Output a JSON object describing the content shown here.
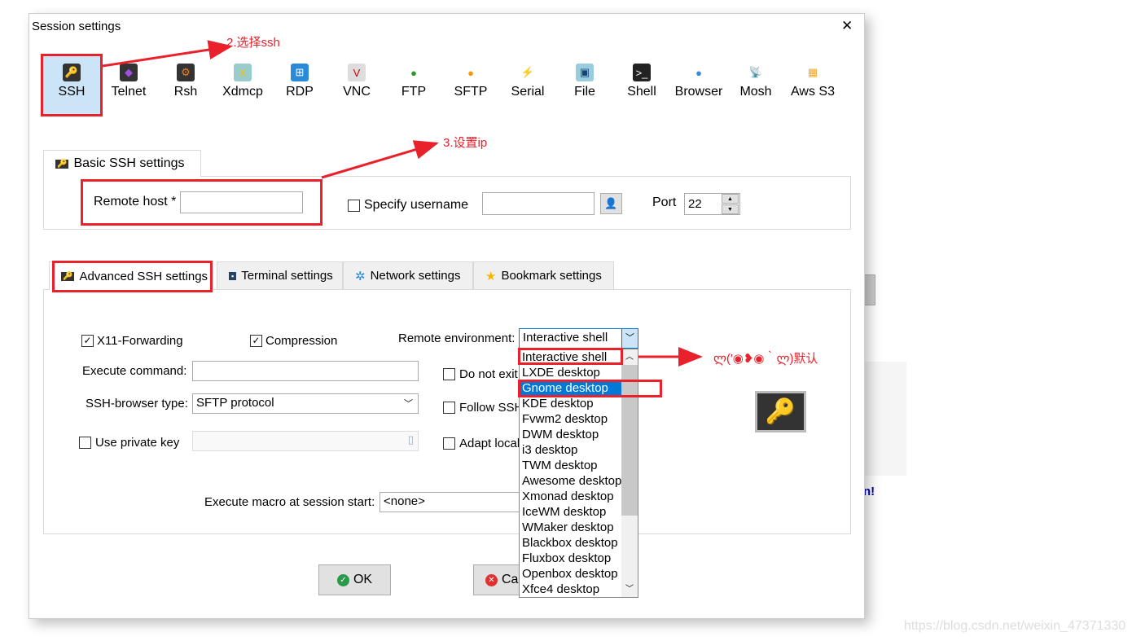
{
  "window": {
    "title": "Session settings",
    "close": "✕"
  },
  "protocols": [
    {
      "label": "SSH",
      "icon": "key-icon",
      "glyph": "🔑",
      "bg": "#333",
      "selected": true
    },
    {
      "label": "Telnet",
      "icon": "crystal-icon",
      "glyph": "◆",
      "bg": "#333",
      "color": "#a050e0"
    },
    {
      "label": "Rsh",
      "icon": "gears-icon",
      "glyph": "⚙",
      "bg": "#333",
      "color": "#f08020"
    },
    {
      "label": "Xdmcp",
      "icon": "x-monitor-icon",
      "glyph": "X",
      "bg": "#9cc"
    },
    {
      "label": "RDP",
      "icon": "windows-monitor-icon",
      "glyph": "⊞",
      "bg": "#2a8ad8",
      "color": "#fff"
    },
    {
      "label": "VNC",
      "icon": "vnc-monitor-icon",
      "glyph": "V",
      "bg": "#ddd",
      "color": "#c00"
    },
    {
      "label": "FTP",
      "icon": "green-globe-icon",
      "glyph": "●",
      "bg": "transparent",
      "color": "#2a9a2a"
    },
    {
      "label": "SFTP",
      "icon": "orange-globe-icon",
      "glyph": "●",
      "bg": "transparent",
      "color": "#f59a10"
    },
    {
      "label": "Serial",
      "icon": "plug-icon",
      "glyph": "⚡",
      "bg": "transparent",
      "color": "#777"
    },
    {
      "label": "File",
      "icon": "file-monitor-icon",
      "glyph": "▣",
      "bg": "#9cd",
      "color": "#147"
    },
    {
      "label": "Shell",
      "icon": "terminal-icon",
      "glyph": ">_",
      "bg": "#222",
      "color": "#fff"
    },
    {
      "label": "Browser",
      "icon": "globe-icon",
      "glyph": "●",
      "bg": "transparent",
      "color": "#3a8ad8"
    },
    {
      "label": "Mosh",
      "icon": "satellite-icon",
      "glyph": "📡",
      "bg": "transparent",
      "color": "#357"
    },
    {
      "label": "Aws S3",
      "icon": "cubes-icon",
      "glyph": "▦",
      "bg": "transparent",
      "color": "#f5a623"
    }
  ],
  "annotations": {
    "step2": "2.选择ssh",
    "step3": "3.设置ip",
    "default_note": "ლ(′◉❥◉｀ლ)默认"
  },
  "basic": {
    "tab": "Basic SSH settings",
    "remote_host_label": "Remote host *",
    "remote_host_value": "",
    "specify_username_label": "Specify username",
    "specify_username_checked": false,
    "username_value": "",
    "port_label": "Port",
    "port_value": "22"
  },
  "adv_tabs": [
    "Advanced SSH settings",
    "Terminal settings",
    "Network settings",
    "Bookmark settings"
  ],
  "advanced": {
    "x11_label": "X11-Forwarding",
    "x11_checked": true,
    "compression_label": "Compression",
    "compression_checked": true,
    "remote_env_label": "Remote environment:",
    "remote_env_value": "Interactive shell",
    "exec_cmd_label": "Execute command:",
    "exec_cmd_value": "",
    "do_not_exit_label": "Do not exit",
    "browser_type_label": "SSH-browser type:",
    "browser_type_value": "SFTP protocol",
    "follow_label": "Follow SSH",
    "private_key_label": "Use private key",
    "private_key_checked": false,
    "adapt_label": "Adapt locale",
    "macro_label": "Execute macro at session start:",
    "macro_value": "<none>"
  },
  "dropdown_options": [
    "Interactive shell",
    "LXDE desktop",
    "Gnome desktop",
    "KDE desktop",
    "Fvwm2 desktop",
    "DWM desktop",
    "i3 desktop",
    "TWM desktop",
    "Awesome desktop",
    "Xmonad desktop",
    "IceWM desktop",
    "WMaker desktop",
    "Blackbox desktop",
    "Fluxbox desktop",
    "Openbox desktop",
    "Xfce4 desktop"
  ],
  "dropdown_highlighted": "Gnome desktop",
  "buttons": {
    "ok": "OK",
    "cancel": "Ca"
  },
  "background": {
    "fragment": "n!",
    "watermark": "https://blog.csdn.net/weixin_47371330"
  },
  "colors": {
    "annotation": "#e8212b",
    "highlight": "#0078d7",
    "selected_bg": "#cce4f7"
  }
}
